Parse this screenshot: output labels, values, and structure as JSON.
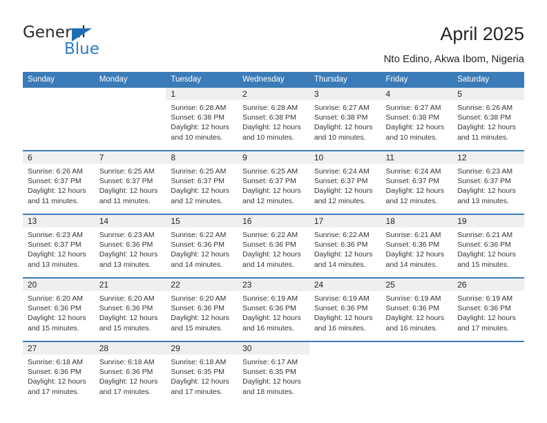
{
  "brand": {
    "name_top": "General",
    "name_bottom": "Blue",
    "triangle_color": "#1f6db5",
    "blue_color": "#2a7ec4"
  },
  "header": {
    "title": "April 2025",
    "subtitle": "Nto Edino, Akwa Ibom, Nigeria",
    "header_bg": "#3b7cb8",
    "daynum_band_bg": "#efefef"
  },
  "weekdays": [
    "Sunday",
    "Monday",
    "Tuesday",
    "Wednesday",
    "Thursday",
    "Friday",
    "Saturday"
  ],
  "labels": {
    "sunrise_prefix": "Sunrise:",
    "sunset_prefix": "Sunset:",
    "daylight_prefix": "Daylight:"
  },
  "weeks": [
    [
      {
        "day": "",
        "blank": true
      },
      {
        "day": "",
        "blank": true
      },
      {
        "day": "1",
        "sunrise": "Sunrise: 6:28 AM",
        "sunset": "Sunset: 6:38 PM",
        "daylight_line1": "Daylight: 12 hours",
        "daylight_line2": "and 10 minutes."
      },
      {
        "day": "2",
        "sunrise": "Sunrise: 6:28 AM",
        "sunset": "Sunset: 6:38 PM",
        "daylight_line1": "Daylight: 12 hours",
        "daylight_line2": "and 10 minutes."
      },
      {
        "day": "3",
        "sunrise": "Sunrise: 6:27 AM",
        "sunset": "Sunset: 6:38 PM",
        "daylight_line1": "Daylight: 12 hours",
        "daylight_line2": "and 10 minutes."
      },
      {
        "day": "4",
        "sunrise": "Sunrise: 6:27 AM",
        "sunset": "Sunset: 6:38 PM",
        "daylight_line1": "Daylight: 12 hours",
        "daylight_line2": "and 10 minutes."
      },
      {
        "day": "5",
        "sunrise": "Sunrise: 6:26 AM",
        "sunset": "Sunset: 6:38 PM",
        "daylight_line1": "Daylight: 12 hours",
        "daylight_line2": "and 11 minutes."
      }
    ],
    [
      {
        "day": "6",
        "sunrise": "Sunrise: 6:26 AM",
        "sunset": "Sunset: 6:37 PM",
        "daylight_line1": "Daylight: 12 hours",
        "daylight_line2": "and 11 minutes."
      },
      {
        "day": "7",
        "sunrise": "Sunrise: 6:25 AM",
        "sunset": "Sunset: 6:37 PM",
        "daylight_line1": "Daylight: 12 hours",
        "daylight_line2": "and 11 minutes."
      },
      {
        "day": "8",
        "sunrise": "Sunrise: 6:25 AM",
        "sunset": "Sunset: 6:37 PM",
        "daylight_line1": "Daylight: 12 hours",
        "daylight_line2": "and 12 minutes."
      },
      {
        "day": "9",
        "sunrise": "Sunrise: 6:25 AM",
        "sunset": "Sunset: 6:37 PM",
        "daylight_line1": "Daylight: 12 hours",
        "daylight_line2": "and 12 minutes."
      },
      {
        "day": "10",
        "sunrise": "Sunrise: 6:24 AM",
        "sunset": "Sunset: 6:37 PM",
        "daylight_line1": "Daylight: 12 hours",
        "daylight_line2": "and 12 minutes."
      },
      {
        "day": "11",
        "sunrise": "Sunrise: 6:24 AM",
        "sunset": "Sunset: 6:37 PM",
        "daylight_line1": "Daylight: 12 hours",
        "daylight_line2": "and 12 minutes."
      },
      {
        "day": "12",
        "sunrise": "Sunrise: 6:23 AM",
        "sunset": "Sunset: 6:37 PM",
        "daylight_line1": "Daylight: 12 hours",
        "daylight_line2": "and 13 minutes."
      }
    ],
    [
      {
        "day": "13",
        "sunrise": "Sunrise: 6:23 AM",
        "sunset": "Sunset: 6:37 PM",
        "daylight_line1": "Daylight: 12 hours",
        "daylight_line2": "and 13 minutes."
      },
      {
        "day": "14",
        "sunrise": "Sunrise: 6:23 AM",
        "sunset": "Sunset: 6:36 PM",
        "daylight_line1": "Daylight: 12 hours",
        "daylight_line2": "and 13 minutes."
      },
      {
        "day": "15",
        "sunrise": "Sunrise: 6:22 AM",
        "sunset": "Sunset: 6:36 PM",
        "daylight_line1": "Daylight: 12 hours",
        "daylight_line2": "and 14 minutes."
      },
      {
        "day": "16",
        "sunrise": "Sunrise: 6:22 AM",
        "sunset": "Sunset: 6:36 PM",
        "daylight_line1": "Daylight: 12 hours",
        "daylight_line2": "and 14 minutes."
      },
      {
        "day": "17",
        "sunrise": "Sunrise: 6:22 AM",
        "sunset": "Sunset: 6:36 PM",
        "daylight_line1": "Daylight: 12 hours",
        "daylight_line2": "and 14 minutes."
      },
      {
        "day": "18",
        "sunrise": "Sunrise: 6:21 AM",
        "sunset": "Sunset: 6:36 PM",
        "daylight_line1": "Daylight: 12 hours",
        "daylight_line2": "and 14 minutes."
      },
      {
        "day": "19",
        "sunrise": "Sunrise: 6:21 AM",
        "sunset": "Sunset: 6:36 PM",
        "daylight_line1": "Daylight: 12 hours",
        "daylight_line2": "and 15 minutes."
      }
    ],
    [
      {
        "day": "20",
        "sunrise": "Sunrise: 6:20 AM",
        "sunset": "Sunset: 6:36 PM",
        "daylight_line1": "Daylight: 12 hours",
        "daylight_line2": "and 15 minutes."
      },
      {
        "day": "21",
        "sunrise": "Sunrise: 6:20 AM",
        "sunset": "Sunset: 6:36 PM",
        "daylight_line1": "Daylight: 12 hours",
        "daylight_line2": "and 15 minutes."
      },
      {
        "day": "22",
        "sunrise": "Sunrise: 6:20 AM",
        "sunset": "Sunset: 6:36 PM",
        "daylight_line1": "Daylight: 12 hours",
        "daylight_line2": "and 15 minutes."
      },
      {
        "day": "23",
        "sunrise": "Sunrise: 6:19 AM",
        "sunset": "Sunset: 6:36 PM",
        "daylight_line1": "Daylight: 12 hours",
        "daylight_line2": "and 16 minutes."
      },
      {
        "day": "24",
        "sunrise": "Sunrise: 6:19 AM",
        "sunset": "Sunset: 6:36 PM",
        "daylight_line1": "Daylight: 12 hours",
        "daylight_line2": "and 16 minutes."
      },
      {
        "day": "25",
        "sunrise": "Sunrise: 6:19 AM",
        "sunset": "Sunset: 6:36 PM",
        "daylight_line1": "Daylight: 12 hours",
        "daylight_line2": "and 16 minutes."
      },
      {
        "day": "26",
        "sunrise": "Sunrise: 6:19 AM",
        "sunset": "Sunset: 6:36 PM",
        "daylight_line1": "Daylight: 12 hours",
        "daylight_line2": "and 17 minutes."
      }
    ],
    [
      {
        "day": "27",
        "sunrise": "Sunrise: 6:18 AM",
        "sunset": "Sunset: 6:36 PM",
        "daylight_line1": "Daylight: 12 hours",
        "daylight_line2": "and 17 minutes."
      },
      {
        "day": "28",
        "sunrise": "Sunrise: 6:18 AM",
        "sunset": "Sunset: 6:36 PM",
        "daylight_line1": "Daylight: 12 hours",
        "daylight_line2": "and 17 minutes."
      },
      {
        "day": "29",
        "sunrise": "Sunrise: 6:18 AM",
        "sunset": "Sunset: 6:35 PM",
        "daylight_line1": "Daylight: 12 hours",
        "daylight_line2": "and 17 minutes."
      },
      {
        "day": "30",
        "sunrise": "Sunrise: 6:17 AM",
        "sunset": "Sunset: 6:35 PM",
        "daylight_line1": "Daylight: 12 hours",
        "daylight_line2": "and 18 minutes."
      },
      {
        "day": "",
        "blank": true
      },
      {
        "day": "",
        "blank": true
      },
      {
        "day": "",
        "blank": true
      }
    ]
  ]
}
